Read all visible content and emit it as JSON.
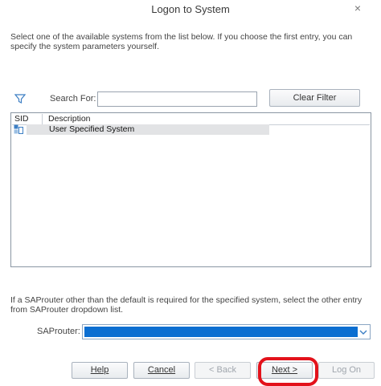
{
  "window": {
    "title": "Logon to System",
    "close_label": "×"
  },
  "instructions": "Select one of the available systems from the list below. If you choose the first entry, you can specify the system parameters yourself.",
  "filter": {
    "icon": "filter-icon",
    "search_label": "Search For:",
    "search_value": "",
    "clear_label": "Clear Filter"
  },
  "list": {
    "columns": [
      "SID",
      "Description"
    ],
    "rows": [
      {
        "sid_icon": "system-icon",
        "description": "User Specified System"
      }
    ]
  },
  "saprouter": {
    "info": "If a SAProuter other than the default is required for the specified system, select the other entry from SAProuter dropdown list.",
    "label": "SAProuter:",
    "value": "",
    "chevron_icon": "chevron-down-icon"
  },
  "footer": {
    "help": "Help",
    "cancel": "Cancel",
    "back": "< Back",
    "next": "Next >",
    "logon": "Log On"
  },
  "colors": {
    "accent": "#0a6ed1",
    "highlight": "#e3121b"
  }
}
